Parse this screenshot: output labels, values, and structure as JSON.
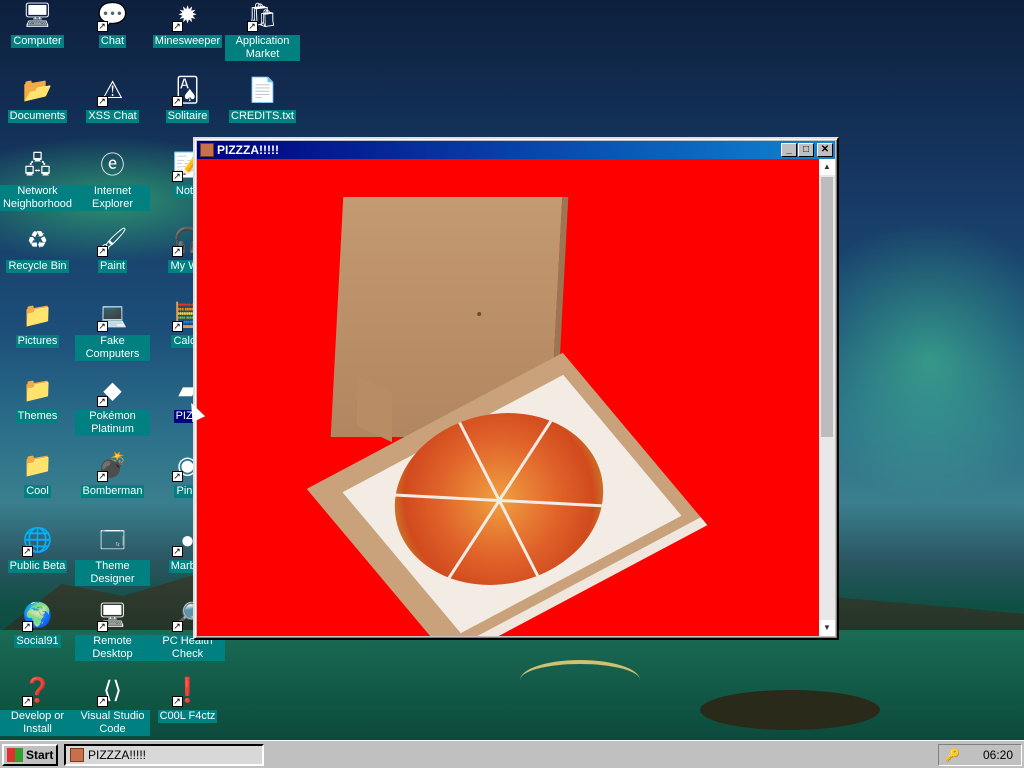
{
  "desktop": {
    "icons": [
      {
        "label": "Computer",
        "icon": "computer-icon",
        "glyph": "🖥",
        "shortcut": false
      },
      {
        "label": "Chat",
        "icon": "chat-bubble-icon",
        "glyph": "💬",
        "shortcut": true
      },
      {
        "label": "Minesweeper",
        "icon": "mine-icon",
        "glyph": "✹",
        "shortcut": true
      },
      {
        "label": "Application Market",
        "icon": "shopping-bag-icon",
        "glyph": "🛍",
        "shortcut": true
      },
      {
        "label": "Documents",
        "icon": "folder-documents-icon",
        "glyph": "📂",
        "shortcut": false
      },
      {
        "label": "XSS Chat",
        "icon": "chat-warning-icon",
        "glyph": "⚠",
        "shortcut": true
      },
      {
        "label": "Solitaire",
        "icon": "cards-icon",
        "glyph": "🂡",
        "shortcut": true
      },
      {
        "label": "CREDITS.txt",
        "icon": "text-file-icon",
        "glyph": "📄",
        "shortcut": false
      },
      {
        "label": "Network Neighborhood",
        "icon": "network-icon",
        "glyph": "🖧",
        "shortcut": false
      },
      {
        "label": "Internet Explorer",
        "icon": "browser-icon",
        "glyph": "ⓔ",
        "shortcut": false
      },
      {
        "label": "Note",
        "icon": "notepad-icon",
        "glyph": "📝",
        "shortcut": true
      },
      {
        "label": "Recycle Bin",
        "icon": "recycle-bin-icon",
        "glyph": "♻",
        "shortcut": false
      },
      {
        "label": "Paint",
        "icon": "paint-icon",
        "glyph": "🖌",
        "shortcut": true
      },
      {
        "label": "My We",
        "icon": "headphones-icon",
        "glyph": "🎧",
        "shortcut": true
      },
      {
        "label": "Pictures",
        "icon": "folder-pictures-icon",
        "glyph": "📁",
        "shortcut": false
      },
      {
        "label": "Fake Computers",
        "icon": "fake-computer-icon",
        "glyph": "💻",
        "shortcut": true
      },
      {
        "label": "Calcu",
        "icon": "calculator-icon",
        "glyph": "🧮",
        "shortcut": true
      },
      {
        "label": "Themes",
        "icon": "folder-themes-icon",
        "glyph": "📁",
        "shortcut": false
      },
      {
        "label": "Pokémon Platinum",
        "icon": "pokemon-icon",
        "glyph": "◆",
        "shortcut": true
      },
      {
        "label": "PIZZ",
        "icon": "pizza-box-icon",
        "glyph": "▰",
        "shortcut": false
      },
      {
        "label": "Cool",
        "icon": "folder-cool-icon",
        "glyph": "📁",
        "shortcut": false
      },
      {
        "label": "Bomberman",
        "icon": "bomberman-icon",
        "glyph": "💣",
        "shortcut": true
      },
      {
        "label": "Pinb",
        "icon": "pinball-icon",
        "glyph": "◉",
        "shortcut": true
      },
      {
        "label": "Public Beta",
        "icon": "globe-windows-icon",
        "glyph": "🌐",
        "shortcut": true
      },
      {
        "label": "Theme Designer",
        "icon": "window-designer-icon",
        "glyph": "🗔",
        "shortcut": false
      },
      {
        "label": "Marble",
        "icon": "marble-icon",
        "glyph": "●",
        "shortcut": true
      },
      {
        "label": "Social91",
        "icon": "globe-icon",
        "glyph": "🌍",
        "shortcut": true
      },
      {
        "label": "Remote Desktop",
        "icon": "remote-desktop-icon",
        "glyph": "🖥",
        "shortcut": true
      },
      {
        "label": "PC Health Check",
        "icon": "health-check-icon",
        "glyph": "🔎",
        "shortcut": true
      },
      {
        "label": "Develop or Install",
        "icon": "develop-install-icon",
        "glyph": "❓",
        "shortcut": true
      },
      {
        "label": "Visual Studio Code",
        "icon": "vscode-icon",
        "glyph": "⟨⟩",
        "shortcut": true
      },
      {
        "label": "C00L F4ctz",
        "icon": "cool-facts-icon",
        "glyph": "❗",
        "shortcut": true
      }
    ]
  },
  "window": {
    "title": "PIZZZA!!!!!",
    "minimize": "_",
    "maximize": "□",
    "close": "✕"
  },
  "taskbar": {
    "start_label": "Start",
    "tasks": [
      "PIZZZA!!!!!"
    ],
    "clock": "06:20"
  },
  "colors": {
    "desktop_label_bg": "#008080",
    "window_content_bg": "#ff0000",
    "titlebar_start": "#000080",
    "titlebar_end": "#1084d0"
  }
}
